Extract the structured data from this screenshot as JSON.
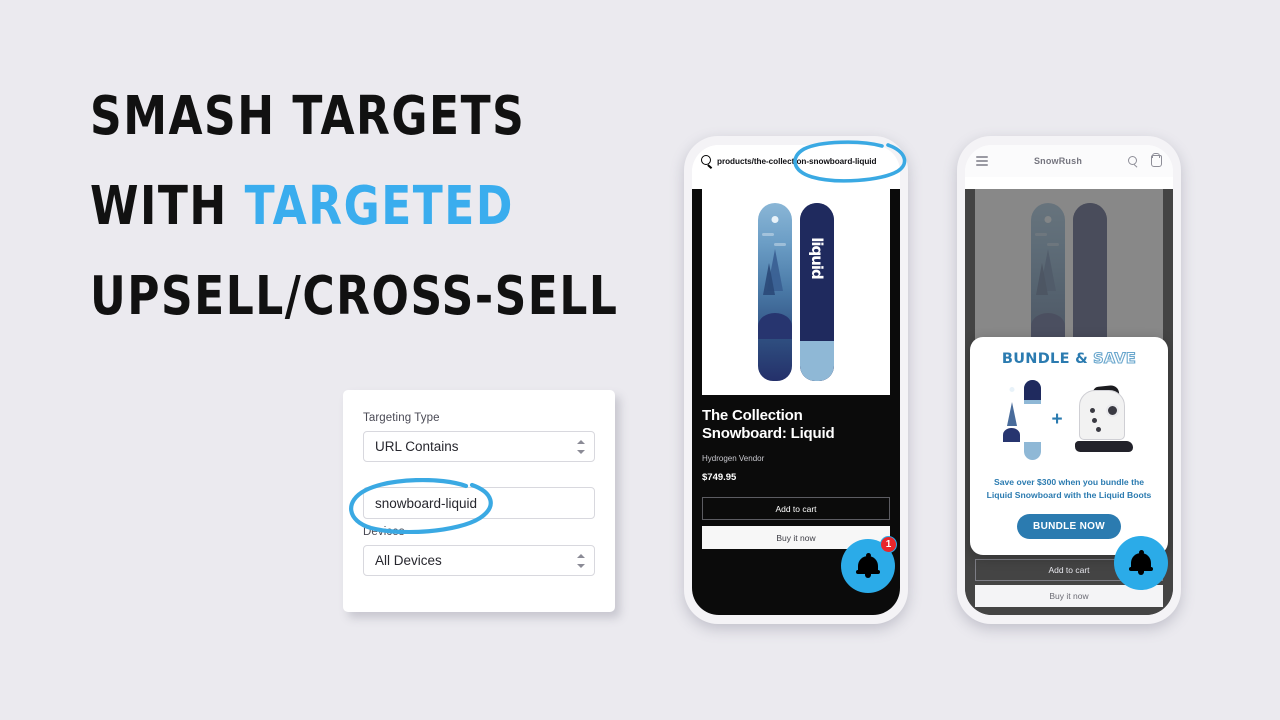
{
  "theme": {
    "background": "#ebeaef",
    "accent_blue": "#3aadee",
    "fab_blue": "#2babe8",
    "bundle_blue": "#2b7bb0",
    "badge_red": "#e8262b"
  },
  "headline": {
    "line1": "SMASH TARGETS",
    "line2_plain": "WITH ",
    "line2_accent": "TARGETED",
    "line3_accent": "UPSELL/CROSS-SELL"
  },
  "targeting_card": {
    "type_label": "Targeting Type",
    "type_value": "URL Contains",
    "url_value": "snowboard-liquid",
    "devices_label": "Devices",
    "devices_value": "All Devices",
    "annotation": "hand-drawn-circle"
  },
  "phone1": {
    "url_bar": {
      "icon": "search-icon",
      "url": "products/the-collection-snowboard-liquid",
      "annotation": "hand-drawn-circle"
    },
    "product": {
      "image_alt": "snowboard-pair-liquid",
      "board_right_text": "liquid",
      "title": "The Collection Snowboard: Liquid",
      "vendor": "Hydrogen Vendor",
      "price": "$749.95",
      "add_to_cart": "Add to cart",
      "buy_it_now": "Buy it now"
    },
    "fab": {
      "icon": "bell-icon",
      "badge": "1"
    }
  },
  "phone2": {
    "header": {
      "menu_icon": "hamburger-icon",
      "store_name": "SnowRush",
      "search_icon": "search-icon",
      "bag_icon": "shopping-bag-icon"
    },
    "product": {
      "add_to_cart": "Add to cart",
      "buy_it_now": "Buy it now"
    },
    "bundle_popup": {
      "heading_solid": "BUNDLE &",
      "heading_outline": "SAVE",
      "plus": "+",
      "item1_alt": "liquid-snowboard",
      "item2_alt": "white-snowboard-boot",
      "copy_line1": "Save over $300 when you bundle the",
      "copy_line2": "Liquid Snowboard with the Liquid Boots",
      "cta": "BUNDLE NOW"
    },
    "fab": {
      "icon": "bell-icon"
    }
  }
}
